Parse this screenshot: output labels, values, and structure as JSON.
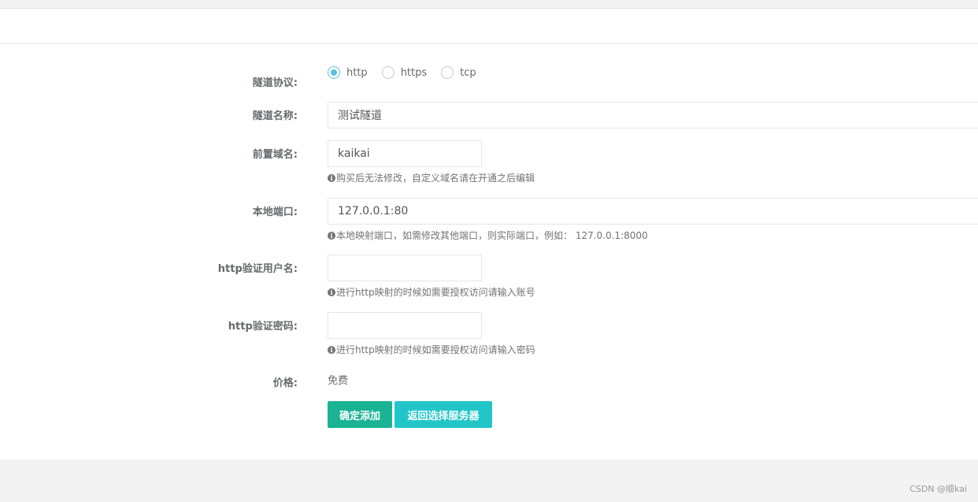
{
  "form": {
    "protocol": {
      "label": "隧道协议:",
      "options": [
        "http",
        "https",
        "tcp"
      ],
      "selected": "http"
    },
    "tunnel_name": {
      "label": "隧道名称:",
      "value": "测试隧道"
    },
    "prefix_domain": {
      "label": "前置域名:",
      "value": "kaikai",
      "help": "购买后无法修改，自定义域名请在开通之后编辑"
    },
    "local_port": {
      "label": "本地端口:",
      "value": "127.0.0.1:80",
      "help": "本地映射端口，如需修改其他端口，则实际端口，例如： 127.0.0.1:8000"
    },
    "http_user": {
      "label": "http验证用户名:",
      "value": "",
      "help": "进行http映射的时候如需要授权访问请输入账号"
    },
    "http_pass": {
      "label": "http验证密码:",
      "value": "",
      "help": "进行http映射的时候如需要授权访问请输入密码"
    },
    "price": {
      "label": "价格:",
      "value": "免费"
    },
    "buttons": {
      "confirm": "确定添加",
      "back": "返回选择服务器"
    }
  },
  "icons": {
    "help": "info-circle-icon"
  },
  "colors": {
    "primary": "#1ab394",
    "info": "#23c6c8",
    "radio_checked": "#5bc0de"
  },
  "watermark": "CSDN @顺kai"
}
